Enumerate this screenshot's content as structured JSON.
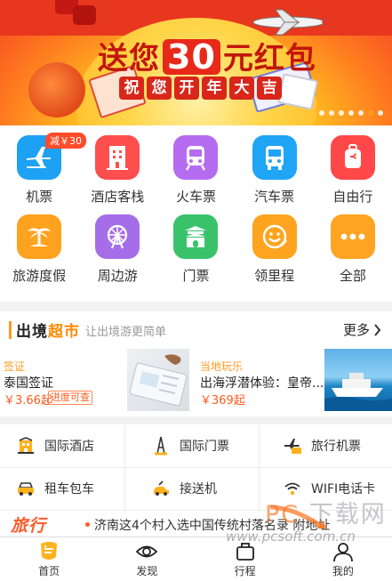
{
  "banner": {
    "headline_before": "送您",
    "amount": "30",
    "headline_after": "元红包",
    "sub_chars": [
      "祝",
      "您",
      "开",
      "年",
      "大",
      "吉"
    ],
    "active_slide": 6,
    "slide_count": 7
  },
  "grid": {
    "items": [
      {
        "label": "机票",
        "icon": "airplane-icon",
        "color": "#1da1f2",
        "badge": "减￥30"
      },
      {
        "label": "酒店客栈",
        "icon": "hotel-icon",
        "color": "#ff4e4e"
      },
      {
        "label": "火车票",
        "icon": "train-icon",
        "color": "#b66cf0"
      },
      {
        "label": "汽车票",
        "icon": "bus-icon",
        "color": "#1ea5f5"
      },
      {
        "label": "自由行",
        "icon": "luggage-icon",
        "color": "#ff4848"
      },
      {
        "label": "旅游度假",
        "icon": "palm-tree-icon",
        "color": "#ffa21e"
      },
      {
        "label": "周边游",
        "icon": "ferris-wheel-icon",
        "color": "#a56ee8"
      },
      {
        "label": "门票",
        "icon": "gate-icon",
        "color": "#3ac26b"
      },
      {
        "label": "领里程",
        "icon": "smiley-icon",
        "color": "#ffa41f"
      },
      {
        "label": "全部",
        "icon": "more-dots-icon",
        "color": "#ffa422"
      }
    ]
  },
  "market": {
    "logo_prefix": "出境",
    "logo_suffix": "超市",
    "slogan": "让出境游更简单",
    "more_label": "更多",
    "cards": [
      {
        "tag": "签证",
        "name": "泰国签证",
        "price": "￥3.66起",
        "chip": "进度可查"
      },
      {
        "tag": "当地玩乐",
        "name": "出海浮潜体验：皇帝...",
        "price": "￥369起"
      }
    ]
  },
  "services": [
    {
      "label": "国际酒店",
      "icon": "hotel-building-icon"
    },
    {
      "label": "国际门票",
      "icon": "tower-icon"
    },
    {
      "label": "旅行机票",
      "icon": "plane-ticket-icon"
    },
    {
      "label": "租车包车",
      "icon": "car-icon"
    },
    {
      "label": "接送机",
      "icon": "pickup-car-icon"
    },
    {
      "label": "WIFI电话卡",
      "icon": "wifi-icon"
    }
  ],
  "news": {
    "tag": "旅行",
    "text": "济南这4个村入选中国传统村落名录 附地址"
  },
  "tabbar": [
    {
      "label": "首页",
      "icon": "home-icon"
    },
    {
      "label": "发现",
      "icon": "eye-icon"
    },
    {
      "label": "行程",
      "icon": "suitcase-icon"
    },
    {
      "label": "我的",
      "icon": "profile-icon"
    }
  ],
  "watermark": {
    "line1_left": "PC",
    "line1_right": "下载网",
    "line2": "www.pcsoft.com.cn"
  },
  "colors": {
    "accent": "#ff9a1f",
    "price": "#ff5a1f",
    "tab_active": "#ff9a1f"
  }
}
